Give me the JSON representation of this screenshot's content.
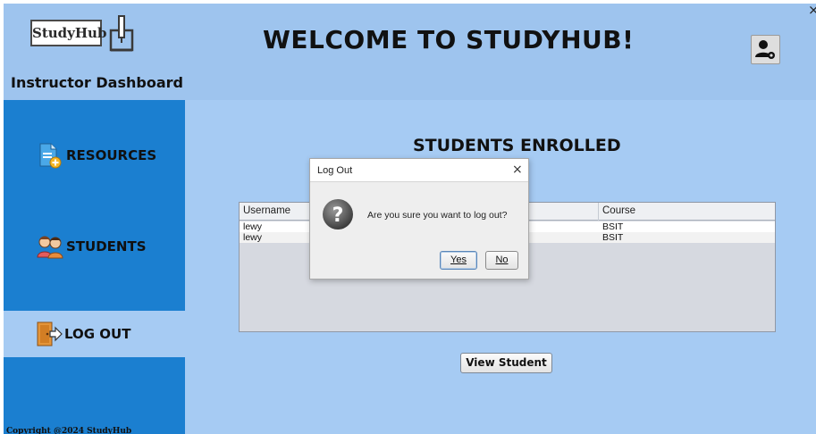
{
  "header": {
    "logo_text": "StudyHub",
    "dashboard_title": "Instructor Dashboard",
    "welcome": "WELCOME TO STUDYHUB!",
    "close_glyph": "×",
    "profile_icon": "user-gear-icon"
  },
  "sidebar": {
    "items": [
      {
        "label": "RESOURCES",
        "icon": "document-add-icon"
      },
      {
        "label": "STUDENTS",
        "icon": "students-icon"
      },
      {
        "label": "LOG OUT",
        "icon": "door-exit-icon"
      }
    ],
    "copyright": "Copyright @2024  StudyHub"
  },
  "main": {
    "section_title": "STUDENTS ENROLLED",
    "table": {
      "columns": [
        "Username",
        "Course"
      ],
      "rows": [
        [
          "lewy",
          "BSIT"
        ],
        [
          "lewy",
          "BSIT"
        ]
      ]
    },
    "view_button": "View Student"
  },
  "dialog": {
    "title": "Log Out",
    "close_glyph": "×",
    "message": "Are you sure you want to log out?",
    "yes_label": "Yes",
    "no_label": "No",
    "icon": "question-icon"
  },
  "colors": {
    "header_bg": "#9ec4ee",
    "sidebar_bg": "#1b7fd0",
    "main_bg": "#a6cbf3",
    "selected_nav_bg": "#a6cbf3"
  }
}
